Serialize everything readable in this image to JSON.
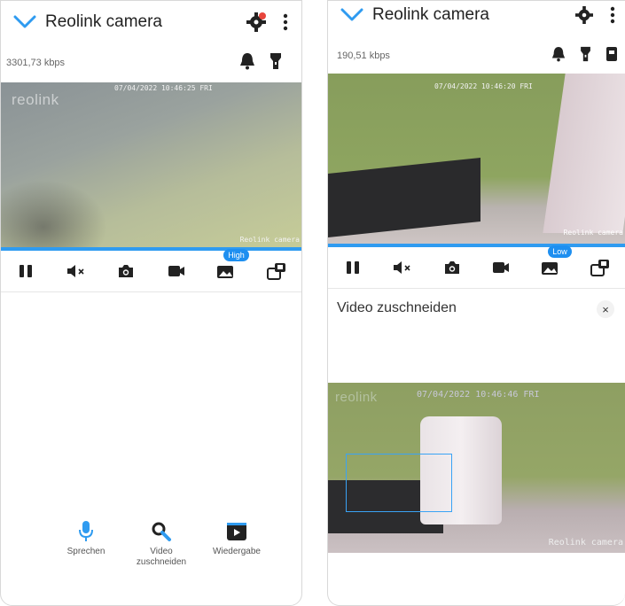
{
  "left": {
    "title": "Reolink camera",
    "bitrate": "3301,73 kbps",
    "osd_time": "07/04/2022 10:46:25 FRI",
    "osd_name": "Reolink camera",
    "logo": "reolink",
    "quality_badge": "High",
    "actions": [
      {
        "label": "Sprechen",
        "icon": "microphone-icon"
      },
      {
        "label": "Video\nzuschneiden",
        "icon": "zoom-search-icon"
      },
      {
        "label": "Wiedergabe",
        "icon": "playback-icon"
      }
    ]
  },
  "right": {
    "title": "Reolink camera",
    "bitrate": "190,51 kbps",
    "osd_time": "07/04/2022 10:46:20 FRI",
    "osd_name": "Reolink camera",
    "quality_badge": "Low",
    "crop_panel_title": "Video zuschneiden",
    "close": "×",
    "crop_osd_time": "07/04/2022 10:46:46 FRI",
    "crop_osd_name": "Reolink camera",
    "crop_logo": "reolink"
  },
  "colors": {
    "accent": "#2f9bf0",
    "notification_dot": "#e8453c"
  }
}
